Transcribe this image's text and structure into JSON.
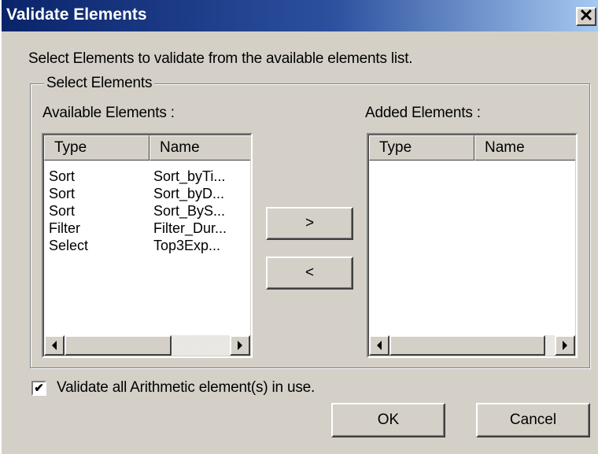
{
  "window": {
    "title": "Validate Elements",
    "close_glyph": "✕"
  },
  "instructions": "Select Elements to validate from the available elements list.",
  "group": {
    "label": "Select Elements",
    "available": {
      "label": "Available Elements :",
      "columns": [
        "Type",
        "Name"
      ],
      "rows": [
        [
          "Sort",
          "Sort_byTi..."
        ],
        [
          "Sort",
          "Sort_byD..."
        ],
        [
          "Sort",
          "Sort_ByS..."
        ],
        [
          "Filter",
          "Filter_Dur..."
        ],
        [
          "Select",
          "Top3Exp..."
        ]
      ]
    },
    "added": {
      "label": "Added Elements :",
      "columns": [
        "Type",
        "Name"
      ],
      "rows": []
    },
    "add_button": ">",
    "remove_button": "<"
  },
  "checkbox": {
    "label": "Validate all Arithmetic element(s) in use.",
    "checked": true,
    "check_glyph": "✔"
  },
  "buttons": {
    "ok": "OK",
    "cancel": "Cancel"
  },
  "colors": {
    "titlebar": "#0a246a",
    "face": "#d4d0c8"
  },
  "icons": {
    "scroll_left": "left-arrow-icon",
    "scroll_right": "right-arrow-icon"
  }
}
